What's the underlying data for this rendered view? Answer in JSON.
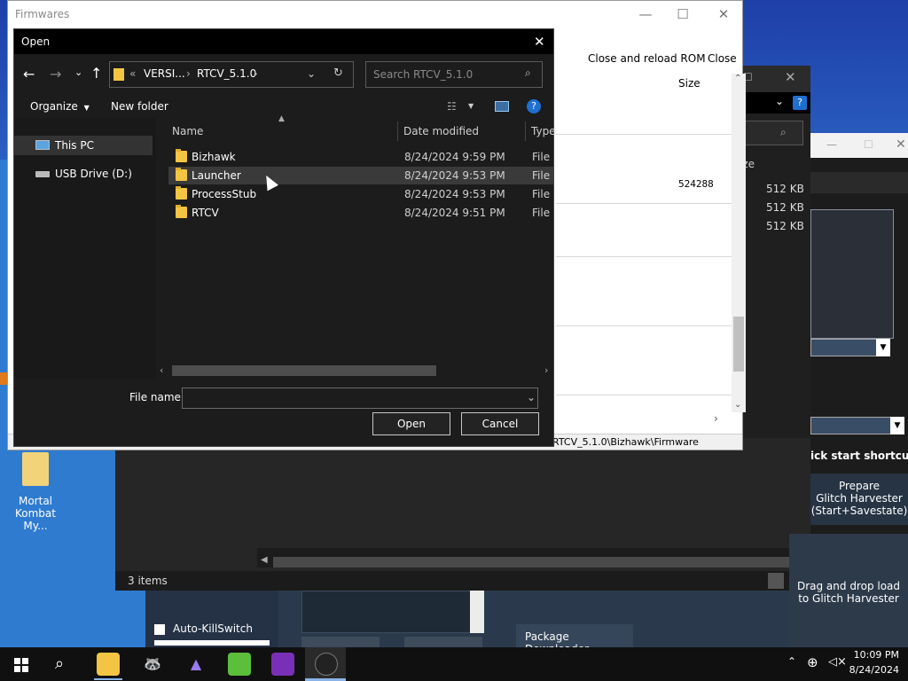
{
  "desktop": {
    "icon_label": "Mortal\nKombat My...",
    "icon_label_line1": "Mortal",
    "icon_label_line2": "Kombat My..."
  },
  "back_app": {
    "size_header": "ize",
    "sizes": [
      "512 KB",
      "512 KB",
      "512 KB"
    ],
    "shortcuts_title": "ick start shortcuts",
    "prepare_line1": "Prepare",
    "prepare_line2": "Glitch Harvester",
    "prepare_line3": "(Start+Savestate)",
    "drag_line1": "Drag and drop load",
    "drag_line2": "to Glitch Harvester",
    "status_count": "3 items",
    "autokill_label": "Auto-KillSwitch",
    "package_label": "Package Downloader"
  },
  "firmwares_window": {
    "title": "Firmwares",
    "close_reload": "Close and reload ROM",
    "close": "Close",
    "size_header": "Size",
    "size_value": "524288",
    "status_path": "RTCV_5.1.0\\Bizhawk\\Firmware"
  },
  "open_dialog": {
    "title": "Open",
    "breadcrumb": [
      "VERSI...",
      "RTCV_5.1.0"
    ],
    "breadcrumb_prefix": "«",
    "search_placeholder": "Search RTCV_5.1.0",
    "organize": "Organize",
    "new_folder": "New folder",
    "nav": [
      {
        "label": "This PC",
        "icon": "computer-icon"
      },
      {
        "label": "USB Drive (D:)",
        "icon": "drive-icon"
      }
    ],
    "columns": {
      "name": "Name",
      "date": "Date modified",
      "type": "Type"
    },
    "files": [
      {
        "name": "Bizhawk",
        "date": "8/24/2024 9:59 PM",
        "type": "File folder"
      },
      {
        "name": "Launcher",
        "date": "8/24/2024 9:53 PM",
        "type": "File folder",
        "selected": true
      },
      {
        "name": "ProcessStub",
        "date": "8/24/2024 9:53 PM",
        "type": "File folder"
      },
      {
        "name": "RTCV",
        "date": "8/24/2024 9:51 PM",
        "type": "File folder"
      }
    ],
    "file_name_label": "File name:",
    "file_name_value": "",
    "open_button": "Open",
    "cancel_button": "Cancel"
  },
  "taskbar": {
    "time": "10:09 PM",
    "date": "8/24/2024"
  },
  "colors": {
    "folder": "#f4c542",
    "dialog_bg": "#191919",
    "desktop": "#2e7bd0"
  }
}
